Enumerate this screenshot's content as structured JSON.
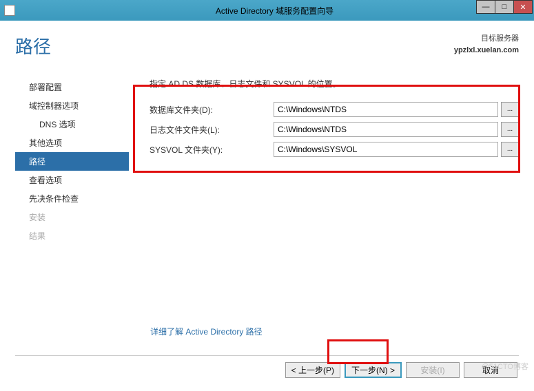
{
  "window": {
    "title": "Active Directory 域服务配置向导"
  },
  "header": {
    "page_title": "路径",
    "target_label": "目标服务器",
    "target_name": "ypzlxl.xuelan.com"
  },
  "sidebar": {
    "items": [
      {
        "label": "部署配置",
        "sub": false
      },
      {
        "label": "域控制器选项",
        "sub": false
      },
      {
        "label": "DNS 选项",
        "sub": true
      },
      {
        "label": "其他选项",
        "sub": false
      },
      {
        "label": "路径",
        "sub": false,
        "active": true
      },
      {
        "label": "查看选项",
        "sub": false
      },
      {
        "label": "先决条件检查",
        "sub": false
      },
      {
        "label": "安装",
        "sub": false,
        "disabled": true
      },
      {
        "label": "结果",
        "sub": false,
        "disabled": true
      }
    ]
  },
  "main": {
    "instruction": "指定 AD DS 数据库、日志文件和 SYSVOL 的位置。",
    "rows": [
      {
        "label": "数据库文件夹(D):",
        "value": "C:\\Windows\\NTDS"
      },
      {
        "label": "日志文件文件夹(L):",
        "value": "C:\\Windows\\NTDS"
      },
      {
        "label": "SYSVOL 文件夹(Y):",
        "value": "C:\\Windows\\SYSVOL"
      }
    ],
    "browse": "...",
    "more_link": "详细了解 Active Directory 路径"
  },
  "footer": {
    "prev": "< 上一步(P)",
    "next": "下一步(N) >",
    "install": "安装(I)",
    "cancel": "取消"
  },
  "watermark": "@51CTO博客"
}
